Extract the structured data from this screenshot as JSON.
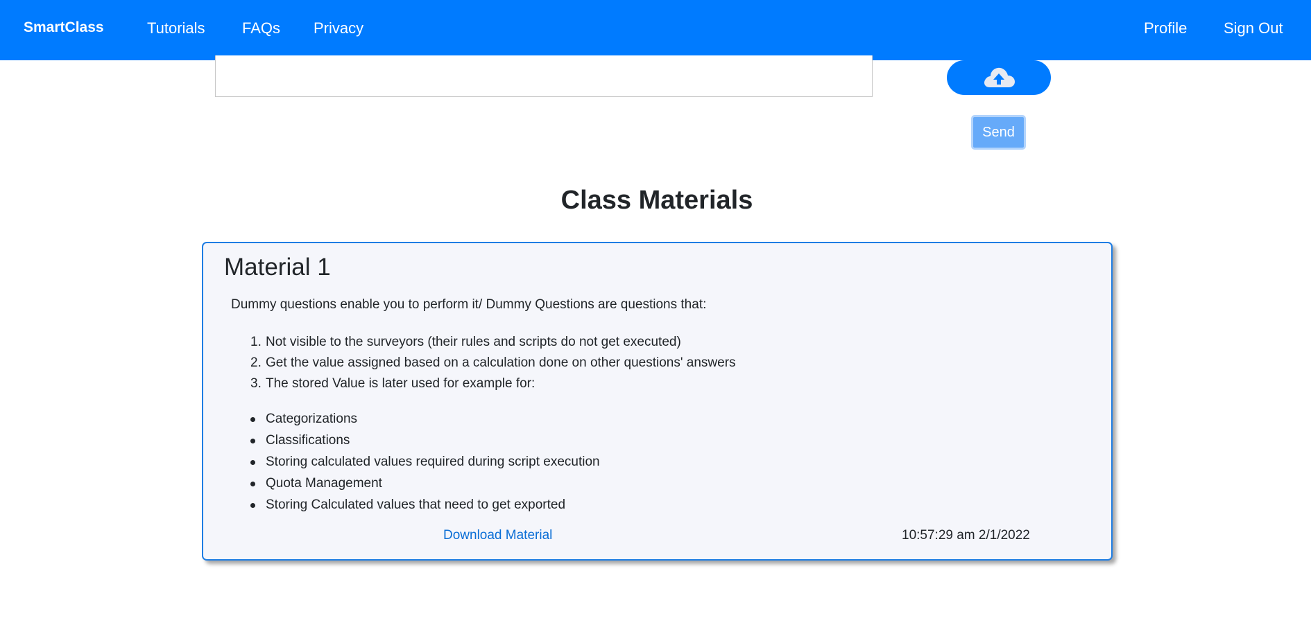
{
  "navbar": {
    "brand": "SmartClass",
    "links": [
      "Tutorials",
      "FAQs",
      "Privacy"
    ],
    "right_links": [
      "Profile",
      "Sign Out"
    ],
    "color": "#007bff"
  },
  "composer": {
    "upload_icon": "cloud-upload-icon",
    "send_label": "Send"
  },
  "section": {
    "title": "Class Materials"
  },
  "material": {
    "title": "Material 1",
    "intro": "Dummy questions enable you to perform it/ Dummy Questions are questions that:",
    "numbered": [
      "Not visible to the surveyors (their rules and scripts do not get executed)",
      "Get the value assigned based on a calculation done on other questions' answers",
      "The stored Value is later used for example for:"
    ],
    "numbers": [
      "1.",
      "2.",
      "3."
    ],
    "bullets": [
      "Categorizations",
      "Classifications",
      "Storing calculated values required during script execution",
      "Quota Management",
      "Storing Calculated values that need to get exported"
    ],
    "download_label": "Download Material",
    "timestamp": "10:57:29 am 2/1/2022"
  }
}
